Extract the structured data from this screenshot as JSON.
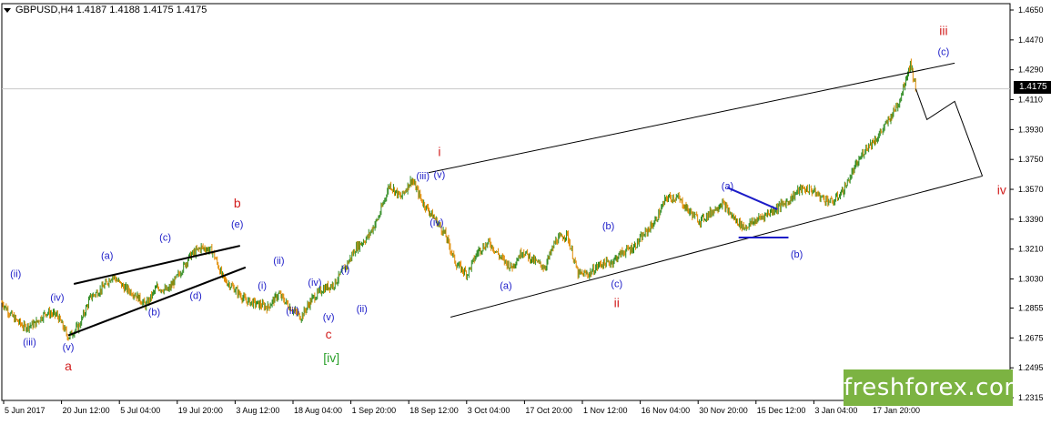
{
  "header": {
    "symbol": "GBPUSD,H4",
    "ohlc": "1.4187 1.4188 1.4175 1.4175"
  },
  "current_price": "1.4175",
  "watermark": "freshforex.com",
  "colors": {
    "candle_up": "#2e8b22",
    "candle_down": "#e08a00",
    "label_blue": "#1c1cc8",
    "label_red": "#d21e1e",
    "label_green": "#2aa02a",
    "trend_line": "#000000",
    "triangle_line": "#1c1cc8",
    "watermark_bg": "#7cb342"
  },
  "axis": {
    "y_ticks": [
      "1.4650",
      "1.4470",
      "1.4290",
      "1.4110",
      "1.3930",
      "1.3750",
      "1.3570",
      "1.3390",
      "1.3210",
      "1.3030",
      "1.2855",
      "1.2675",
      "1.2495",
      "1.2315"
    ],
    "x_ticks": [
      "5 Jun 2017",
      "20 Jun 12:00",
      "5 Jul 04:00",
      "19 Jul 20:00",
      "3 Aug 12:00",
      "18 Aug 04:00",
      "1 Sep 20:00",
      "18 Sep 12:00",
      "3 Oct 04:00",
      "17 Oct 20:00",
      "1 Nov 12:00",
      "16 Nov 04:00",
      "30 Nov 20:00",
      "15 Dec 12:00",
      "3 Jan 04:00",
      "17 Jan 20:00"
    ]
  },
  "chart_data": {
    "type": "candlestick",
    "instrument": "GBPUSD",
    "timeframe": "H4",
    "ylim": [
      1.2315,
      1.465
    ],
    "last_price": 1.4175,
    "price_path": [
      [
        0,
        1.289
      ],
      [
        2,
        1.28
      ],
      [
        4,
        1.274
      ],
      [
        6,
        1.276
      ],
      [
        8,
        1.283
      ],
      [
        10,
        1.281
      ],
      [
        12,
        1.268
      ],
      [
        14,
        1.275
      ],
      [
        16,
        1.292
      ],
      [
        18,
        1.297
      ],
      [
        20,
        1.305
      ],
      [
        22,
        1.298
      ],
      [
        24,
        1.294
      ],
      [
        26,
        1.287
      ],
      [
        28,
        1.298
      ],
      [
        30,
        1.296
      ],
      [
        32,
        1.306
      ],
      [
        34,
        1.317
      ],
      [
        36,
        1.322
      ],
      [
        38,
        1.32
      ],
      [
        40,
        1.303
      ],
      [
        42,
        1.297
      ],
      [
        44,
        1.29
      ],
      [
        46,
        1.288
      ],
      [
        48,
        1.286
      ],
      [
        50,
        1.294
      ],
      [
        52,
        1.286
      ],
      [
        54,
        1.28
      ],
      [
        56,
        1.291
      ],
      [
        58,
        1.297
      ],
      [
        60,
        1.3
      ],
      [
        62,
        1.31
      ],
      [
        64,
        1.322
      ],
      [
        66,
        1.328
      ],
      [
        68,
        1.34
      ],
      [
        70,
        1.36
      ],
      [
        72,
        1.352
      ],
      [
        74,
        1.363
      ],
      [
        76,
        1.349
      ],
      [
        78,
        1.34
      ],
      [
        80,
        1.33
      ],
      [
        82,
        1.312
      ],
      [
        84,
        1.306
      ],
      [
        86,
        1.32
      ],
      [
        88,
        1.325
      ],
      [
        90,
        1.316
      ],
      [
        92,
        1.31
      ],
      [
        94,
        1.32
      ],
      [
        96,
        1.314
      ],
      [
        98,
        1.31
      ],
      [
        100,
        1.326
      ],
      [
        102,
        1.33
      ],
      [
        104,
        1.306
      ],
      [
        106,
        1.306
      ],
      [
        108,
        1.312
      ],
      [
        110,
        1.313
      ],
      [
        112,
        1.319
      ],
      [
        114,
        1.322
      ],
      [
        116,
        1.33
      ],
      [
        118,
        1.338
      ],
      [
        120,
        1.352
      ],
      [
        122,
        1.352
      ],
      [
        124,
        1.344
      ],
      [
        126,
        1.338
      ],
      [
        128,
        1.343
      ],
      [
        130,
        1.349
      ],
      [
        132,
        1.34
      ],
      [
        134,
        1.334
      ],
      [
        136,
        1.338
      ],
      [
        138,
        1.342
      ],
      [
        140,
        1.346
      ],
      [
        142,
        1.35
      ],
      [
        144,
        1.357
      ],
      [
        146,
        1.357
      ],
      [
        148,
        1.352
      ],
      [
        150,
        1.349
      ],
      [
        152,
        1.357
      ],
      [
        154,
        1.37
      ],
      [
        156,
        1.382
      ],
      [
        158,
        1.388
      ],
      [
        160,
        1.398
      ],
      [
        162,
        1.41
      ],
      [
        164,
        1.433
      ],
      [
        165,
        1.4175
      ]
    ],
    "projection_path": [
      [
        165,
        1.4175
      ],
      [
        167,
        1.399
      ],
      [
        172,
        1.41
      ],
      [
        177,
        1.365
      ]
    ],
    "trend_lines": [
      {
        "name": "upper-channel",
        "from": [
          77,
          1.367
        ],
        "to": [
          172,
          1.433
        ]
      },
      {
        "name": "lower-channel",
        "from": [
          81,
          1.28
        ],
        "to": [
          177,
          1.365
        ]
      },
      {
        "name": "wedge-upper",
        "from": [
          13,
          1.3
        ],
        "to": [
          43,
          1.323
        ]
      },
      {
        "name": "wedge-lower",
        "from": [
          12,
          1.269
        ],
        "to": [
          44,
          1.31
        ]
      }
    ],
    "triangle_lines": [
      {
        "from": [
          131,
          1.358
        ],
        "to": [
          140,
          1.345
        ]
      },
      {
        "from": [
          133,
          1.328
        ],
        "to": [
          142,
          1.328
        ]
      }
    ],
    "wave_labels": [
      {
        "text": "(ii)",
        "x": 2.5,
        "y": 1.304,
        "color": "blue"
      },
      {
        "text": "(iii)",
        "x": 5,
        "y": 1.263,
        "color": "blue"
      },
      {
        "text": "(iv)",
        "x": 10,
        "y": 1.29,
        "color": "blue"
      },
      {
        "text": "(v)",
        "x": 12,
        "y": 1.26,
        "color": "blue"
      },
      {
        "text": "a",
        "x": 12,
        "y": 1.248,
        "color": "red"
      },
      {
        "text": "(a)",
        "x": 19,
        "y": 1.315,
        "color": "blue"
      },
      {
        "text": "(b)",
        "x": 27.5,
        "y": 1.281,
        "color": "blue"
      },
      {
        "text": "(c)",
        "x": 29.5,
        "y": 1.326,
        "color": "blue"
      },
      {
        "text": "(d)",
        "x": 35,
        "y": 1.291,
        "color": "blue"
      },
      {
        "text": "(e)",
        "x": 42.5,
        "y": 1.334,
        "color": "blue"
      },
      {
        "text": "b",
        "x": 42.5,
        "y": 1.346,
        "color": "red"
      },
      {
        "text": "(i)",
        "x": 47,
        "y": 1.297,
        "color": "blue"
      },
      {
        "text": "(ii)",
        "x": 50,
        "y": 1.312,
        "color": "blue"
      },
      {
        "text": "(iii)",
        "x": 52.5,
        "y": 1.282,
        "color": "blue"
      },
      {
        "text": "(iv)",
        "x": 56.5,
        "y": 1.299,
        "color": "blue"
      },
      {
        "text": "(v)",
        "x": 59,
        "y": 1.278,
        "color": "blue"
      },
      {
        "text": "c",
        "x": 59,
        "y": 1.267,
        "color": "red"
      },
      {
        "text": "[iv]",
        "x": 59.5,
        "y": 1.253,
        "color": "green"
      },
      {
        "text": "(i)",
        "x": 62,
        "y": 1.307,
        "color": "blue"
      },
      {
        "text": "(ii)",
        "x": 65,
        "y": 1.283,
        "color": "blue"
      },
      {
        "text": "(iii)",
        "x": 76,
        "y": 1.363,
        "color": "blue"
      },
      {
        "text": "(v)",
        "x": 79,
        "y": 1.364,
        "color": "blue"
      },
      {
        "text": "i",
        "x": 79,
        "y": 1.377,
        "color": "red"
      },
      {
        "text": "(iv)",
        "x": 78.5,
        "y": 1.335,
        "color": "blue"
      },
      {
        "text": "(a)",
        "x": 91,
        "y": 1.297,
        "color": "blue"
      },
      {
        "text": "(b)",
        "x": 109.5,
        "y": 1.333,
        "color": "blue"
      },
      {
        "text": "(c)",
        "x": 111,
        "y": 1.298,
        "color": "blue"
      },
      {
        "text": "ii",
        "x": 111,
        "y": 1.286,
        "color": "red"
      },
      {
        "text": "(a)",
        "x": 131,
        "y": 1.357,
        "color": "blue"
      },
      {
        "text": "(b)",
        "x": 143.5,
        "y": 1.316,
        "color": "blue"
      },
      {
        "text": "(c)",
        "x": 170,
        "y": 1.438,
        "color": "blue"
      },
      {
        "text": "iii",
        "x": 170,
        "y": 1.45,
        "color": "red"
      },
      {
        "text": "iv",
        "x": 180.5,
        "y": 1.354,
        "color": "red"
      }
    ]
  }
}
